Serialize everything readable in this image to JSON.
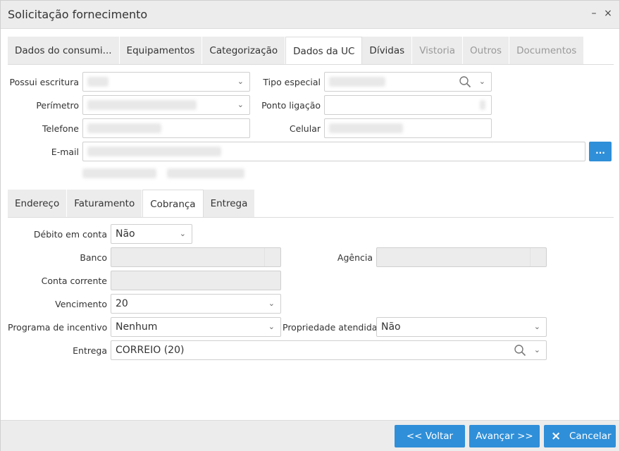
{
  "window": {
    "title": "Solicitação fornecimento",
    "minimize_label": "–",
    "close_label": "×"
  },
  "main_tabs": [
    {
      "label": "Dados do consumi...",
      "state": "normal"
    },
    {
      "label": "Equipamentos",
      "state": "normal"
    },
    {
      "label": "Categorização",
      "state": "normal"
    },
    {
      "label": "Dados da UC",
      "state": "active"
    },
    {
      "label": "Dívidas",
      "state": "normal"
    },
    {
      "label": "Vistoria",
      "state": "disabled"
    },
    {
      "label": "Outros",
      "state": "disabled"
    },
    {
      "label": "Documentos",
      "state": "disabled"
    }
  ],
  "uc_form": {
    "possui_escritura": {
      "label": "Possui escritura"
    },
    "tipo_especial": {
      "label": "Tipo especial"
    },
    "perimetro": {
      "label": "Perímetro"
    },
    "ponto_ligacao": {
      "label": "Ponto ligação"
    },
    "telefone": {
      "label": "Telefone"
    },
    "celular": {
      "label": "Celular"
    },
    "email": {
      "label": "E-mail",
      "button_label": "..."
    }
  },
  "sub_tabs": [
    {
      "label": "Endereço",
      "state": "normal"
    },
    {
      "label": "Faturamento",
      "state": "normal"
    },
    {
      "label": "Cobrança",
      "state": "active"
    },
    {
      "label": "Entrega",
      "state": "normal"
    }
  ],
  "cobranca": {
    "debito_em_conta": {
      "label": "Débito em conta",
      "value": "Não"
    },
    "banco": {
      "label": "Banco",
      "value": ""
    },
    "agencia": {
      "label": "Agência",
      "value": ""
    },
    "conta_corrente": {
      "label": "Conta corrente",
      "value": ""
    },
    "vencimento": {
      "label": "Vencimento",
      "value": "20"
    },
    "programa_incentivo": {
      "label": "Programa de incentivo",
      "value": "Nenhum"
    },
    "propriedade_atendida": {
      "label": "Propriedade atendida",
      "value": "Não"
    },
    "entrega": {
      "label": "Entrega",
      "value": "CORREIO (20)"
    }
  },
  "footer": {
    "voltar_label": "<< Voltar",
    "avancar_label": "Avançar >>",
    "cancelar_label": "Cancelar",
    "cancel_icon": "×"
  },
  "colors": {
    "primary": "#2f8fd8",
    "header_bg": "#ececec",
    "disabled_field": "#ececec"
  }
}
